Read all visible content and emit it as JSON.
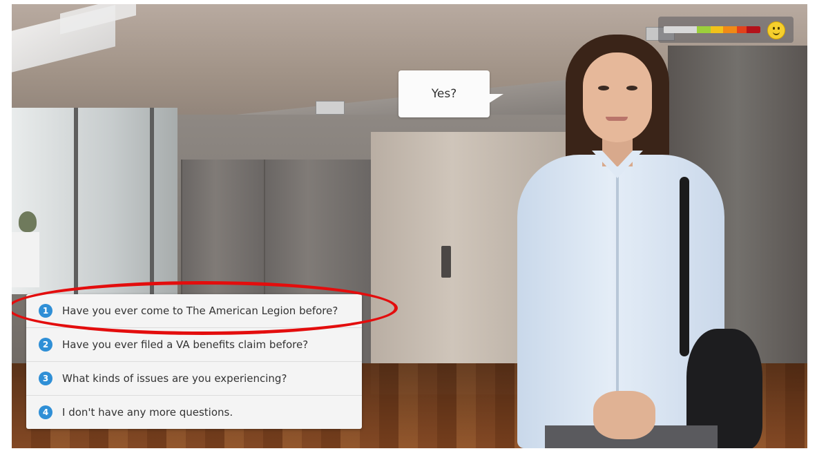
{
  "speech": {
    "text": "Yes?"
  },
  "meter": {
    "segments": [
      "#d8d8d8",
      "#9ccf3b",
      "#f2c21a",
      "#f08a16",
      "#e2421c",
      "#b3121a"
    ],
    "mood_icon": "smiley-face-icon",
    "mood_color": "#f5cf2d"
  },
  "choices": [
    {
      "number": "1",
      "text": "Have you ever come to The American Legion before?"
    },
    {
      "number": "2",
      "text": "Have you ever filed a VA benefits claim before?"
    },
    {
      "number": "3",
      "text": "What kinds of issues are you experiencing?"
    },
    {
      "number": "4",
      "text": "I don't have any more questions."
    }
  ],
  "colors": {
    "choice_number": "#2f8fd6",
    "highlight": "#e30d0d"
  }
}
